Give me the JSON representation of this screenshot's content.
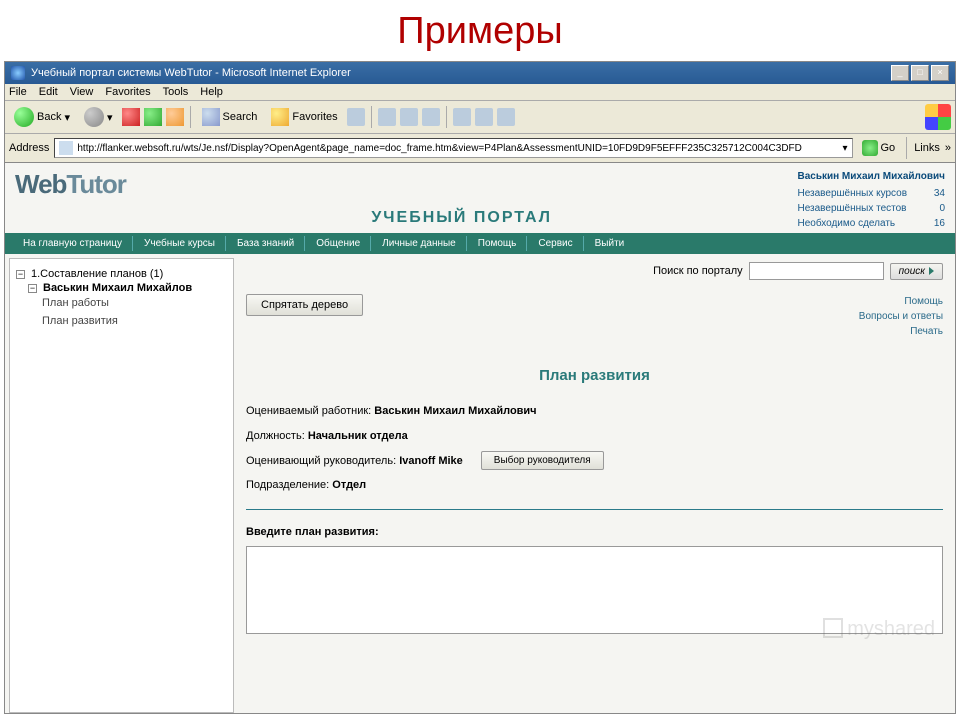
{
  "slide_title": "Примеры",
  "window": {
    "title": "Учебный портал системы WebTutor - Microsoft Internet Explorer",
    "min": "_",
    "max": "□",
    "close": "×"
  },
  "menu": {
    "file": "File",
    "edit": "Edit",
    "view": "View",
    "favorites": "Favorites",
    "tools": "Tools",
    "help": "Help"
  },
  "toolbar": {
    "back": "Back",
    "search": "Search",
    "favorites": "Favorites"
  },
  "addressbar": {
    "label": "Address",
    "url": "http://flanker.websoft.ru/wts/Je.nsf/Display?OpenAgent&page_name=doc_frame.htm&view=P4Plan&AssessmentUNID=10FD9D9F5EFFF235C325712C004C3DFD",
    "go": "Go",
    "links": "Links"
  },
  "portal": {
    "logo_a": "Web",
    "logo_b": "Tutor",
    "title": "УЧЕБНЫЙ ПОРТАЛ",
    "user_name": "Васькин Михаил Михайлович",
    "stats": [
      {
        "label": "Незавершённых курсов",
        "value": "34"
      },
      {
        "label": "Незавершённых тестов",
        "value": "0"
      },
      {
        "label": "Необходимо сделать",
        "value": "16"
      }
    ]
  },
  "nav": [
    "На главную страницу",
    "Учебные курсы",
    "База знаний",
    "Общение",
    "Личные данные",
    "Помощь",
    "Сервис",
    "Выйти"
  ],
  "sidebar": {
    "root": "1.Составление планов (1)",
    "person": "Васькин Михаил Михайлов",
    "children": [
      "План работы",
      "План развития"
    ]
  },
  "search": {
    "label": "Поиск по порталу",
    "button": "поиск"
  },
  "hide_tree": "Спрятать дерево",
  "right_links": [
    "Помощь",
    "Вопросы и ответы",
    "Печать"
  ],
  "page_heading": "План развития",
  "info": {
    "worker_label": "Оцениваемый работник:",
    "worker": "Васькин Михаил Михайлович",
    "position_label": "Должность:",
    "position": "Начальник отдела",
    "supervisor_label": "Оценивающий руководитель:",
    "supervisor": "Ivanoff Mike",
    "select_supervisor": "Выбор руководителя",
    "dept_label": "Подразделение:",
    "dept": "Отдел"
  },
  "plan_label": "Введите план развития:",
  "watermark": "myshared"
}
